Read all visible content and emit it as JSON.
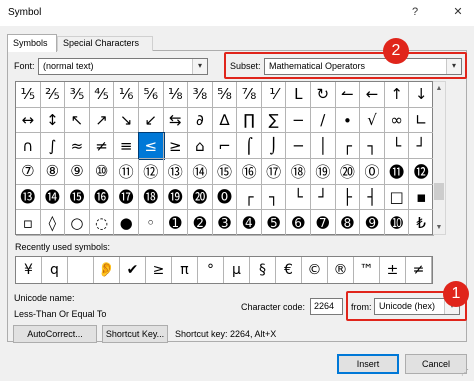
{
  "window": {
    "title": "Symbol",
    "help_glyph": "?",
    "close_glyph": "✕"
  },
  "tabs": [
    {
      "label": "Symbols"
    },
    {
      "label": "Special Characters"
    }
  ],
  "font": {
    "label": "Font:",
    "value": "(normal text)",
    "arrow": "▾"
  },
  "subset": {
    "label": "Subset:",
    "value": "Mathematical Operators",
    "arrow": "▾"
  },
  "grid_cells": [
    [
      "⅕",
      "⅖",
      "⅗",
      "⅘",
      "⅙",
      "⅚",
      "⅛",
      "⅜",
      "⅝",
      "⅞",
      "⅟",
      "Ⅼ",
      "↻",
      "↼",
      "←",
      "↑",
      "↓"
    ],
    [
      "↔",
      "↕",
      "↖",
      "↗",
      "↘",
      "↙",
      "⇆",
      "∂",
      "∆",
      "∏",
      "∑",
      "−",
      "∕",
      "∙",
      "√",
      "∞",
      "∟"
    ],
    [
      "∩",
      "∫",
      "≈",
      "≠",
      "≡",
      "≤",
      "≥",
      "⌂",
      "⌐",
      "⌠",
      "⌡",
      "─",
      "│",
      "┌",
      "┐",
      "└",
      "┘"
    ],
    [
      "⑦",
      "⑧",
      "⑨",
      "⑩",
      "⑪",
      "⑫",
      "⑬",
      "⑭",
      "⑮",
      "⑯",
      "⑰",
      "⑱",
      "⑲",
      "⑳",
      "⓪",
      "⓫",
      "⓬"
    ],
    [
      "⓭",
      "⓮",
      "⓯",
      "⓰",
      "⓱",
      "⓲",
      "⓳",
      "⓴",
      "⓿",
      "┌",
      "┐",
      "└",
      "┘",
      "├",
      "┤",
      "□",
      "▪"
    ],
    [
      "▫",
      "◊",
      "○",
      "◌",
      "●",
      "◦",
      "➊",
      "➋",
      "➌",
      "➍",
      "➎",
      "➏",
      "➐",
      "➑",
      "➒",
      "➓",
      "₺"
    ]
  ],
  "scroll": {
    "up": "▲",
    "down": "▼"
  },
  "recent": {
    "label": "Recently used symbols:",
    "symbols": [
      "¥",
      "q",
      "",
      "👂",
      "✔",
      "≥",
      "π",
      "°",
      "µ",
      "§",
      "€",
      "©",
      "®",
      "™",
      "±",
      "≠"
    ]
  },
  "unicode_name": {
    "label": "Unicode name:",
    "value": "Less-Than Or Equal To"
  },
  "character_code": {
    "label": "Character code:",
    "value": "2264"
  },
  "from": {
    "label": "from:",
    "value": "Unicode (hex)",
    "arrow": "▾"
  },
  "buttons": {
    "autocorrect": "AutoCorrect...",
    "shortcut_key": "Shortcut Key...",
    "insert": "Insert",
    "cancel": "Cancel"
  },
  "shortcut_text": "Shortcut key: 2264, Alt+X",
  "annotations": {
    "badge1": "1",
    "badge2": "2",
    "color": "#e0251b"
  },
  "colors": {
    "selection": "#0078d7"
  }
}
